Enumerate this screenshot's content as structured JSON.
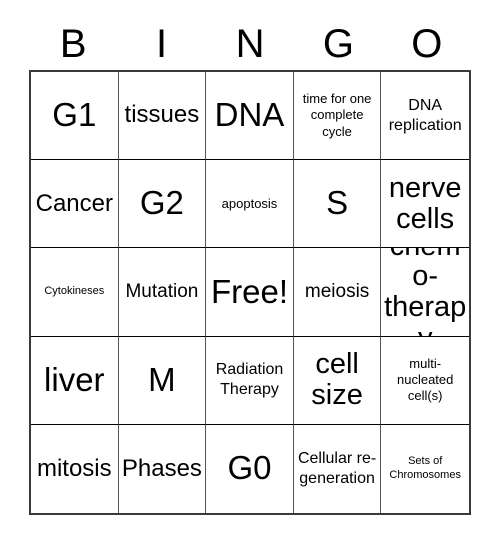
{
  "card": {
    "title_letters": [
      "B",
      "I",
      "N",
      "G",
      "O"
    ],
    "free_space_label": "Free!",
    "colors": {
      "background": "#ffffff",
      "text": "#000000",
      "outer_border": "#3a3a3a",
      "inner_border": "#555555"
    },
    "rows": [
      [
        {
          "text": "G1",
          "size": "fs-xxl"
        },
        {
          "text": "tissues",
          "size": "fs-lg"
        },
        {
          "text": "DNA",
          "size": "fs-xxl"
        },
        {
          "text": "time for one complete cycle",
          "size": "fs-xs"
        },
        {
          "text": "DNA replication",
          "size": "fs-sm"
        }
      ],
      [
        {
          "text": "Cancer",
          "size": "fs-lg"
        },
        {
          "text": "G2",
          "size": "fs-xxl"
        },
        {
          "text": "apoptosis",
          "size": "fs-xs"
        },
        {
          "text": "S",
          "size": "fs-xxl"
        },
        {
          "text": "nerve cells",
          "size": "fs-xl"
        }
      ],
      [
        {
          "text": "Cytokineses",
          "size": "fs-xxs"
        },
        {
          "text": "Mutation",
          "size": "fs-md"
        },
        {
          "text": "Free!",
          "size": "fs-xxl"
        },
        {
          "text": "meiosis",
          "size": "fs-md"
        },
        {
          "text": "chemo-therapy",
          "size": "fs-xl"
        }
      ],
      [
        {
          "text": "liver",
          "size": "fs-xxl"
        },
        {
          "text": "M",
          "size": "fs-xxl"
        },
        {
          "text": "Radiation Therapy",
          "size": "fs-sm"
        },
        {
          "text": "cell size",
          "size": "fs-xl"
        },
        {
          "text": "multi-nucleated cell(s)",
          "size": "fs-xs"
        }
      ],
      [
        {
          "text": "mitosis",
          "size": "fs-lg"
        },
        {
          "text": "Phases",
          "size": "fs-lg"
        },
        {
          "text": "G0",
          "size": "fs-xxl"
        },
        {
          "text": "Cellular re-generation",
          "size": "fs-sm"
        },
        {
          "text": "Sets of Chromosomes",
          "size": "fs-xxs"
        }
      ]
    ]
  }
}
